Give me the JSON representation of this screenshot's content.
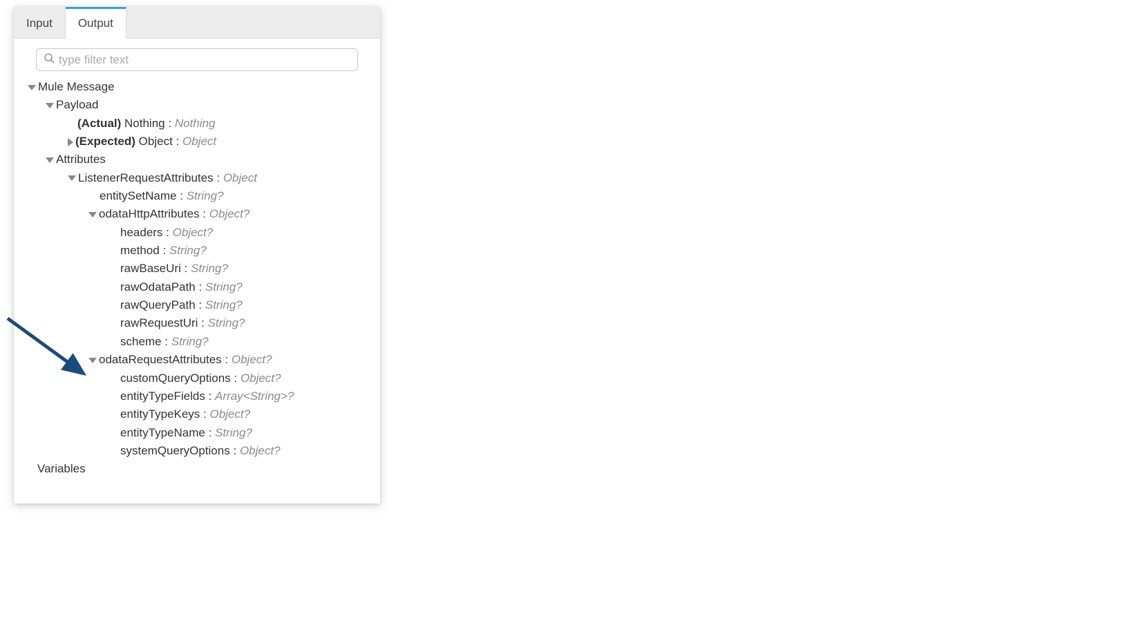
{
  "tabs": {
    "input": "Input",
    "output": "Output"
  },
  "search": {
    "placeholder": "type filter text"
  },
  "tree": {
    "root": "Mule Message",
    "payload": {
      "label": "Payload",
      "actual": {
        "prefix": "(Actual)",
        "name": "Nothing",
        "sep": ":",
        "type": "Nothing"
      },
      "expected": {
        "prefix": "(Expected)",
        "name": "Object",
        "sep": ":",
        "type": "Object"
      }
    },
    "attributes": {
      "label": "Attributes",
      "listener": {
        "name": "ListenerRequestAttributes",
        "sep": ":",
        "type": "Object"
      },
      "entitySetName": {
        "name": "entitySetName",
        "sep": ":",
        "type": "String?"
      },
      "odataHttp": {
        "label": {
          "name": "odataHttpAttributes",
          "sep": ":",
          "type": "Object?"
        },
        "headers": {
          "name": "headers",
          "sep": ":",
          "type": "Object?"
        },
        "method": {
          "name": "method",
          "sep": ":",
          "type": "String?"
        },
        "rawBaseUri": {
          "name": "rawBaseUri",
          "sep": ":",
          "type": "String?"
        },
        "rawOdataPath": {
          "name": "rawOdataPath",
          "sep": ":",
          "type": "String?"
        },
        "rawQueryPath": {
          "name": "rawQueryPath",
          "sep": ":",
          "type": "String?"
        },
        "rawRequestUri": {
          "name": "rawRequestUri",
          "sep": ":",
          "type": "String?"
        },
        "scheme": {
          "name": "scheme",
          "sep": ":",
          "type": "String?"
        }
      },
      "odataReq": {
        "label": {
          "name": "odataRequestAttributes",
          "sep": ":",
          "type": "Object?"
        },
        "customQueryOptions": {
          "name": "customQueryOptions",
          "sep": ":",
          "type": "Object?"
        },
        "entityTypeFields": {
          "name": "entityTypeFields",
          "sep": ":",
          "type": "Array<String>?"
        },
        "entityTypeKeys": {
          "name": "entityTypeKeys",
          "sep": ":",
          "type": "Object?"
        },
        "entityTypeName": {
          "name": "entityTypeName",
          "sep": ":",
          "type": "String?"
        },
        "systemQueryOptions": {
          "name": "systemQueryOptions",
          "sep": ":",
          "type": "Object?"
        }
      }
    },
    "variables": "Variables"
  }
}
